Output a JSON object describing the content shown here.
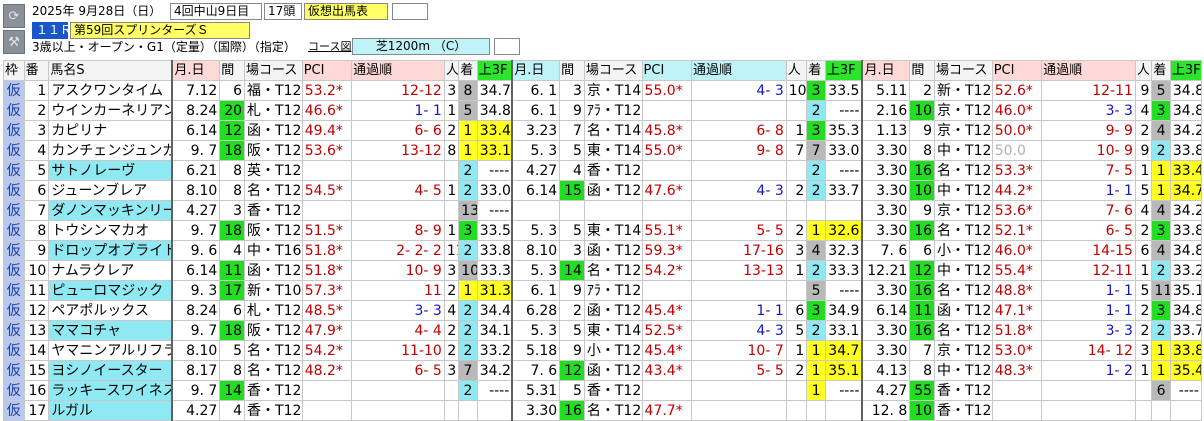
{
  "header": {
    "line1": {
      "date": "2025年  9月28日（日）",
      "kaisai": "4回中山9日目",
      "count": "17頭",
      "badge": "仮想出馬表"
    },
    "line2": {
      "race_no": "１１Ｒ",
      "race_name": "第59回スプリンターズＳ"
    },
    "line3": {
      "conditions": "3歳以上・オープン・G1（定量）（国際）（指定）",
      "course_label": "コース図",
      "course": "芝1200m （C）"
    }
  },
  "table": {
    "headers": [
      "枠",
      "番",
      "馬名S",
      "月.日",
      "間",
      "場コース",
      "PCI",
      "通過順",
      "人",
      "着",
      "上3F",
      "月.日",
      "間",
      "場コース",
      "PCI",
      "通過順",
      "人",
      "着",
      "上3F",
      "月.日",
      "間",
      "場コース",
      "PCI",
      "通過順",
      "人",
      "着",
      "上3F"
    ],
    "rows": [
      {
        "waku": "仮",
        "ban": "1",
        "name": "アスクワンタイム",
        "r": [
          {
            "date": "7.12",
            "kan": "6",
            "course": "福・T12",
            "pci": "53.2*",
            "pass": "12-12",
            "nin": "3",
            "chaku": "8",
            "f3": "34.7"
          },
          {
            "date": "6. 1",
            "kan": "3",
            "course": "京・T14",
            "pci": "55.0*",
            "pass": "4- 3",
            "nin": "10",
            "chaku": "3",
            "f3": "33.5"
          },
          {
            "date": "5.11",
            "kan": "2",
            "course": "新・T12",
            "pci": "52.6*",
            "pass": "12-11",
            "nin": "9",
            "chaku": "5",
            "f3": "34.8"
          }
        ]
      },
      {
        "waku": "仮",
        "ban": "2",
        "name": "ウインカーネリアン",
        "r": [
          {
            "date": "8.24",
            "kan": "20",
            "course": "札・T12",
            "pci": "46.6*",
            "pass": "1- 1",
            "nin": "1",
            "chaku": "5",
            "f3": "34.8"
          },
          {
            "date": "6. 1",
            "kan": "9",
            "course": "ｱﾗ・T12",
            "pci": "",
            "pass": "",
            "nin": "",
            "chaku": "2",
            "f3": "----"
          },
          {
            "date": "2.16",
            "kan": "10",
            "course": "京・T12",
            "pci": "46.0*",
            "pass": "3- 3",
            "nin": "4",
            "chaku": "3",
            "f3": "34.8"
          }
        ]
      },
      {
        "waku": "仮",
        "ban": "3",
        "name": "カピリナ",
        "r": [
          {
            "date": "6.14",
            "kan": "12",
            "course": "函・T12",
            "pci": "49.4*",
            "pass": "6- 6",
            "nin": "2",
            "chaku": "1",
            "f3": "33.4"
          },
          {
            "date": "3.23",
            "kan": "7",
            "course": "名・T14",
            "pci": "45.8*",
            "pass": "6- 8",
            "nin": "1",
            "chaku": "3",
            "f3": "35.3"
          },
          {
            "date": "1.13",
            "kan": "9",
            "course": "京・T12",
            "pci": "50.0*",
            "pass": "9- 9",
            "nin": "2",
            "chaku": "4",
            "f3": "34.2"
          }
        ]
      },
      {
        "waku": "仮",
        "ban": "4",
        "name": "カンチェンジュンガ",
        "r": [
          {
            "date": "9. 7",
            "kan": "18",
            "course": "阪・T12",
            "pci": "53.6*",
            "pass": "13-12",
            "nin": "8",
            "chaku": "1",
            "f3": "33.1"
          },
          {
            "date": "5. 3",
            "kan": "5",
            "course": "東・T14",
            "pci": "55.0*",
            "pass": "9- 8",
            "nin": "7",
            "chaku": "7",
            "f3": "33.0"
          },
          {
            "date": "3.30",
            "kan": "8",
            "course": "中・T12",
            "pci": "50.0",
            "pass": "10- 9",
            "nin": "9",
            "chaku": "2",
            "f3": "33.8"
          }
        ]
      },
      {
        "waku": "仮",
        "ban": "5",
        "name": "サトノレーヴ",
        "r": [
          {
            "date": "6.21",
            "kan": "8",
            "course": "英・T12",
            "pci": "",
            "pass": "",
            "nin": "",
            "chaku": "2",
            "f3": "----"
          },
          {
            "date": "4.27",
            "kan": "4",
            "course": "香・T12",
            "pci": "",
            "pass": "",
            "nin": "",
            "chaku": "2",
            "f3": "----"
          },
          {
            "date": "3.30",
            "kan": "16",
            "course": "名・T12",
            "pci": "53.3*",
            "pass": "7- 5",
            "nin": "1",
            "chaku": "1",
            "f3": "33.4"
          }
        ]
      },
      {
        "waku": "仮",
        "ban": "6",
        "name": "ジューンブレア",
        "r": [
          {
            "date": "8.10",
            "kan": "8",
            "course": "名・T12",
            "pci": "54.5*",
            "pass": "4- 5",
            "nin": "1",
            "chaku": "2",
            "f3": "33.0"
          },
          {
            "date": "6.14",
            "kan": "15",
            "course": "函・T12",
            "pci": "47.6*",
            "pass": "4- 3",
            "nin": "2",
            "chaku": "2",
            "f3": "33.7"
          },
          {
            "date": "3.30",
            "kan": "10",
            "course": "中・T12",
            "pci": "44.2*",
            "pass": "1- 1",
            "nin": "5",
            "chaku": "1",
            "f3": "34.7"
          }
        ]
      },
      {
        "waku": "仮",
        "ban": "7",
        "name": "ダノンマッキンリー",
        "r": [
          {
            "date": "4.27",
            "kan": "3",
            "course": "香・T12",
            "pci": "",
            "pass": "",
            "nin": "",
            "chaku": "13",
            "f3": "----"
          },
          {
            "date": "",
            "kan": "",
            "course": "",
            "pci": "",
            "pass": "",
            "nin": "",
            "chaku": "",
            "f3": ""
          },
          {
            "date": "3.30",
            "kan": "9",
            "course": "京・T12",
            "pci": "53.6*",
            "pass": "7- 6",
            "nin": "4",
            "chaku": "4",
            "f3": "34.2"
          }
        ]
      },
      {
        "waku": "仮",
        "ban": "8",
        "name": "トウシンマカオ",
        "r": [
          {
            "date": "9. 7",
            "kan": "18",
            "course": "阪・T12",
            "pci": "51.5*",
            "pass": "8- 9",
            "nin": "1",
            "chaku": "3",
            "f3": "33.5"
          },
          {
            "date": "5. 3",
            "kan": "5",
            "course": "東・T14",
            "pci": "55.1*",
            "pass": "5- 5",
            "nin": "2",
            "chaku": "1",
            "f3": "32.6"
          },
          {
            "date": "3.30",
            "kan": "16",
            "course": "名・T12",
            "pci": "52.1*",
            "pass": "6- 5",
            "nin": "2",
            "chaku": "3",
            "f3": "33.8"
          }
        ]
      },
      {
        "waku": "仮",
        "ban": "9",
        "name": "ドロップオブライト",
        "r": [
          {
            "date": "9. 6",
            "kan": "4",
            "course": "中・T16",
            "pci": "51.8*",
            "pass": "2- 2- 2",
            "nin": "11",
            "chaku": "2",
            "f3": "33.8"
          },
          {
            "date": "8.10",
            "kan": "3",
            "course": "函・T12",
            "pci": "59.3*",
            "pass": "17-16",
            "nin": "3",
            "chaku": "4",
            "f3": "32.3"
          },
          {
            "date": "7. 6",
            "kan": "6",
            "course": "小・T12",
            "pci": "46.0*",
            "pass": "14-15",
            "nin": "6",
            "chaku": "4",
            "f3": "34.8"
          }
        ]
      },
      {
        "waku": "仮",
        "ban": "10",
        "name": "ナムラクレア",
        "r": [
          {
            "date": "6.14",
            "kan": "11",
            "course": "函・T12",
            "pci": "51.8*",
            "pass": "10- 9",
            "nin": "3",
            "chaku": "10",
            "f3": "33.3"
          },
          {
            "date": "5. 3",
            "kan": "14",
            "course": "名・T12",
            "pci": "54.2*",
            "pass": "13-13",
            "nin": "1",
            "chaku": "2",
            "f3": "33.3"
          },
          {
            "date": "12.21",
            "kan": "12",
            "course": "中・T12",
            "pci": "55.4*",
            "pass": "12-11",
            "nin": "1",
            "chaku": "2",
            "f3": "33.2"
          }
        ]
      },
      {
        "waku": "仮",
        "ban": "11",
        "name": "ピューロマジック",
        "r": [
          {
            "date": "9. 3",
            "kan": "17",
            "course": "新・T10",
            "pci": "57.3*",
            "pass": "11",
            "nin": "2",
            "chaku": "1",
            "f3": "31.3"
          },
          {
            "date": "6. 1",
            "kan": "9",
            "course": "ｱﾗ・T12",
            "pci": "",
            "pass": "",
            "nin": "",
            "chaku": "5",
            "f3": "----"
          },
          {
            "date": "3.30",
            "kan": "16",
            "course": "名・T12",
            "pci": "48.8*",
            "pass": "1- 1",
            "nin": "5",
            "chaku": "11",
            "f3": "35.1"
          }
        ]
      },
      {
        "waku": "仮",
        "ban": "12",
        "name": "ペアポルックス",
        "r": [
          {
            "date": "8.24",
            "kan": "6",
            "course": "札・T12",
            "pci": "48.5*",
            "pass": "3- 3",
            "nin": "4",
            "chaku": "2",
            "f3": "34.4"
          },
          {
            "date": "6.28",
            "kan": "2",
            "course": "函・T12",
            "pci": "45.4*",
            "pass": "1- 1",
            "nin": "6",
            "chaku": "3",
            "f3": "34.9"
          },
          {
            "date": "6.14",
            "kan": "11",
            "course": "函・T12",
            "pci": "47.1*",
            "pass": "1- 1",
            "nin": "2",
            "chaku": "3",
            "f3": "34.8"
          }
        ]
      },
      {
        "waku": "仮",
        "ban": "13",
        "name": "ママコチャ",
        "r": [
          {
            "date": "9. 7",
            "kan": "18",
            "course": "阪・T12",
            "pci": "47.9*",
            "pass": "4- 4",
            "nin": "2",
            "chaku": "2",
            "f3": "34.1"
          },
          {
            "date": "5. 3",
            "kan": "5",
            "course": "東・T14",
            "pci": "52.5*",
            "pass": "4- 3",
            "nin": "5",
            "chaku": "2",
            "f3": "33.1"
          },
          {
            "date": "3.30",
            "kan": "16",
            "course": "名・T12",
            "pci": "51.8*",
            "pass": "3- 3",
            "nin": "2",
            "chaku": "2",
            "f3": "33.7"
          }
        ]
      },
      {
        "waku": "仮",
        "ban": "14",
        "name": "ヤマニンアルリフラ",
        "r": [
          {
            "date": "8.10",
            "kan": "5",
            "course": "名・T12",
            "pci": "54.2*",
            "pass": "11-10",
            "nin": "2",
            "chaku": "2",
            "f3": "33.2"
          },
          {
            "date": "5.18",
            "kan": "9",
            "course": "小・T12",
            "pci": "45.4*",
            "pass": "10- 7",
            "nin": "1",
            "chaku": "1",
            "f3": "34.7"
          },
          {
            "date": "3.30",
            "kan": "7",
            "course": "京・T12",
            "pci": "53.0*",
            "pass": "14- 12",
            "nin": "3",
            "chaku": "1",
            "f3": "33.8"
          }
        ]
      },
      {
        "waku": "仮",
        "ban": "15",
        "name": "ヨシノイースター",
        "r": [
          {
            "date": "8.17",
            "kan": "8",
            "course": "名・T12",
            "pci": "48.2*",
            "pass": "6- 5",
            "nin": "3",
            "chaku": "7",
            "f3": "34.2"
          },
          {
            "date": "7. 6",
            "kan": "12",
            "course": "函・T12",
            "pci": "43.4*",
            "pass": "5- 5",
            "nin": "2",
            "chaku": "1",
            "f3": "35.1"
          },
          {
            "date": "4.13",
            "kan": "8",
            "course": "中・T12",
            "pci": "48.3*",
            "pass": "1- 2",
            "nin": "1",
            "chaku": "1",
            "f3": "35.4"
          }
        ]
      },
      {
        "waku": "仮",
        "ban": "16",
        "name": "ラッキースワイネス",
        "r": [
          {
            "date": "9. 7",
            "kan": "14",
            "course": "香・T12",
            "pci": "",
            "pass": "",
            "nin": "",
            "chaku": "2",
            "f3": "----"
          },
          {
            "date": "5.31",
            "kan": "5",
            "course": "香・T12",
            "pci": "",
            "pass": "",
            "nin": "",
            "chaku": "1",
            "f3": "----"
          },
          {
            "date": "4.27",
            "kan": "55",
            "course": "香・T12",
            "pci": "",
            "pass": "",
            "nin": "",
            "chaku": "6",
            "f3": "----"
          }
        ]
      },
      {
        "waku": "仮",
        "ban": "17",
        "name": "ルガル",
        "r": [
          {
            "date": "4.27",
            "kan": "4",
            "course": "香・T12",
            "pci": "",
            "pass": "",
            "nin": "",
            "chaku": "",
            "f3": ""
          },
          {
            "date": "3.30",
            "kan": "16",
            "course": "名・T12",
            "pci": "47.7*",
            "pass": "",
            "nin": "",
            "chaku": "",
            "f3": ""
          },
          {
            "date": "12. 8",
            "kan": "10",
            "course": "香・T12",
            "pci": "",
            "pass": "",
            "nin": "",
            "chaku": "",
            "f3": ""
          }
        ]
      }
    ]
  },
  "colors": {
    "waku": "#b9c8f0",
    "interval_highlight": "#22dd22",
    "first_place": "#ffff22",
    "second_place": "#8fe9f3",
    "name_highlight": "#8fe9f3",
    "grey_chaku": "#b9b9b9",
    "header_pink": "#ffd8d8"
  },
  "icons": [
    "refresh-icon",
    "wrench-icon"
  ]
}
